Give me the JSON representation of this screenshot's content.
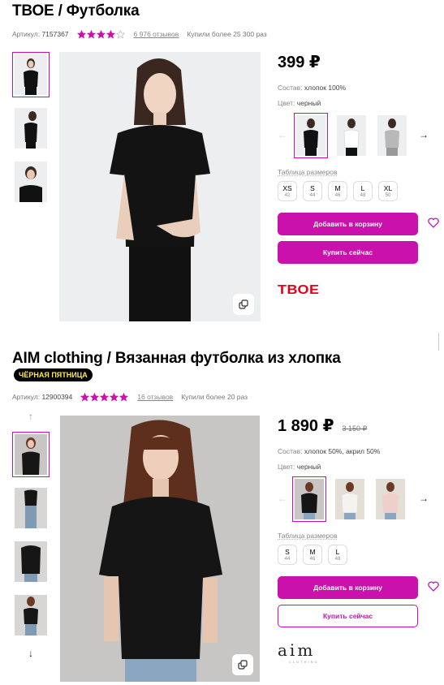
{
  "products": [
    {
      "title": "ТВОЕ / Футболка",
      "article_label": "Артикул:",
      "article": "7157367",
      "rating": 4,
      "reviews": "6 976 отзывов",
      "bought": "Купили более 25 300 раз",
      "price": "399 ₽",
      "composition_label": "Состав:",
      "composition": "хлопок 100%",
      "color_label": "Цвет:",
      "color": "черный",
      "sizes_label": "Таблица размеров",
      "sizes": [
        {
          "s": "XS",
          "r": "42"
        },
        {
          "s": "S",
          "r": "44"
        },
        {
          "s": "M",
          "r": "46"
        },
        {
          "s": "L",
          "r": "48"
        },
        {
          "s": "XL",
          "r": "50"
        }
      ],
      "add_to_cart": "Добавить в корзину",
      "buy_now": "Купить сейчас",
      "brand_logo": "ТВОЕ"
    },
    {
      "title": "AIM clothing / Вязанная футболка из хлопка",
      "promo": "ЧЁРНАЯ ПЯТНИЦА",
      "article_label": "Артикул:",
      "article": "12900394",
      "rating": 5,
      "reviews": "16 отзывов",
      "bought": "Купили более 20 раз",
      "price": "1 890 ₽",
      "old_price": "3 150 ₽",
      "composition_label": "Состав:",
      "composition": "хлопок 50%, акрил 50%",
      "color_label": "Цвет:",
      "color": "черный",
      "sizes_label": "Таблица размеров",
      "sizes": [
        {
          "s": "S",
          "r": "44"
        },
        {
          "s": "M",
          "r": "46"
        },
        {
          "s": "L",
          "r": "48"
        }
      ],
      "add_to_cart": "Добавить в корзину",
      "buy_now": "Купить сейчас",
      "brand_logo": "aim",
      "brand_logo_sub": "CLOTHING"
    }
  ],
  "colors": {
    "accent": "#cb11ab",
    "star": "#cb11ab",
    "promo_bg": "#000000",
    "promo_text": "#ffe94d",
    "brand_red": "#e3001b"
  }
}
